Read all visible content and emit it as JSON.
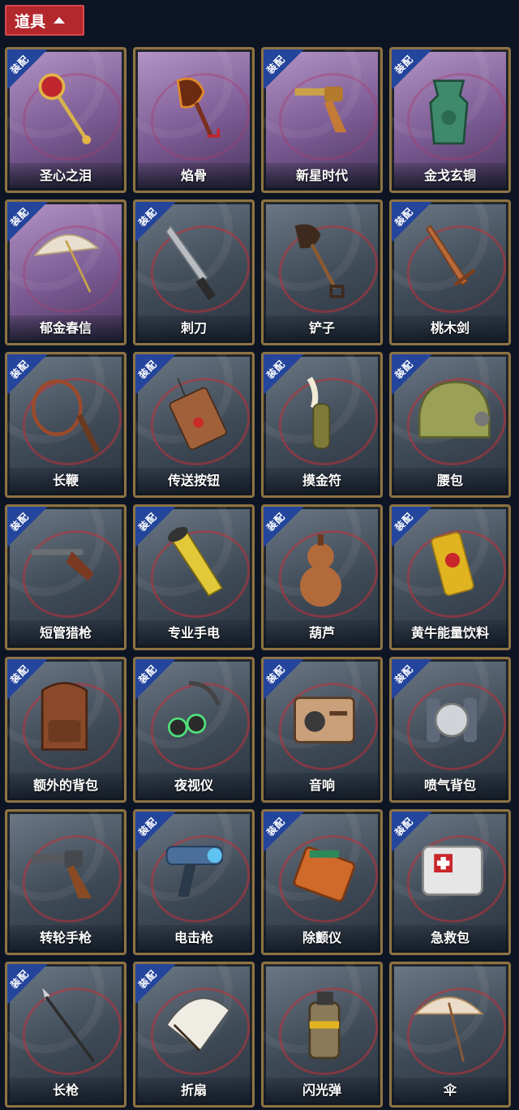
{
  "header": {
    "title": "道具"
  },
  "badge_text": "装配",
  "items": [
    {
      "name": "圣心之泪",
      "equipped": true,
      "purple": true,
      "icon": "scepter-icon"
    },
    {
      "name": "焰骨",
      "equipped": false,
      "purple": true,
      "icon": "bone-shovel-icon"
    },
    {
      "name": "新星时代",
      "equipped": true,
      "purple": true,
      "icon": "revolver-icon"
    },
    {
      "name": "金戈玄铜",
      "equipped": true,
      "purple": true,
      "icon": "bronze-relic-icon"
    },
    {
      "name": "郁金春信",
      "equipped": true,
      "purple": true,
      "icon": "parasol-icon"
    },
    {
      "name": "刺刀",
      "equipped": true,
      "purple": false,
      "icon": "knife-icon"
    },
    {
      "name": "铲子",
      "equipped": false,
      "purple": false,
      "icon": "shovel-icon"
    },
    {
      "name": "桃木剑",
      "equipped": true,
      "purple": false,
      "icon": "wooden-sword-icon"
    },
    {
      "name": "长鞭",
      "equipped": true,
      "purple": false,
      "icon": "whip-icon"
    },
    {
      "name": "传送按钮",
      "equipped": true,
      "purple": false,
      "icon": "remote-button-icon"
    },
    {
      "name": "摸金符",
      "equipped": true,
      "purple": false,
      "icon": "amulet-icon"
    },
    {
      "name": "腰包",
      "equipped": true,
      "purple": false,
      "icon": "waist-bag-icon"
    },
    {
      "name": "短管猎枪",
      "equipped": true,
      "purple": false,
      "icon": "shotgun-icon"
    },
    {
      "name": "专业手电",
      "equipped": true,
      "purple": false,
      "icon": "flashlight-icon"
    },
    {
      "name": "葫芦",
      "equipped": true,
      "purple": false,
      "icon": "gourd-icon"
    },
    {
      "name": "黄牛能量饮料",
      "equipped": true,
      "purple": false,
      "icon": "energy-drink-icon"
    },
    {
      "name": "额外的背包",
      "equipped": true,
      "purple": false,
      "icon": "backpack-icon"
    },
    {
      "name": "夜视仪",
      "equipped": true,
      "purple": false,
      "icon": "night-vision-icon"
    },
    {
      "name": "音响",
      "equipped": true,
      "purple": false,
      "icon": "radio-icon"
    },
    {
      "name": "喷气背包",
      "equipped": true,
      "purple": false,
      "icon": "jetpack-icon"
    },
    {
      "name": "转轮手枪",
      "equipped": false,
      "purple": false,
      "icon": "pistol-icon"
    },
    {
      "name": "电击枪",
      "equipped": true,
      "purple": false,
      "icon": "shock-gun-icon"
    },
    {
      "name": "除颤仪",
      "equipped": true,
      "purple": false,
      "icon": "defibrillator-icon"
    },
    {
      "name": "急救包",
      "equipped": true,
      "purple": false,
      "icon": "first-aid-icon"
    },
    {
      "name": "长枪",
      "equipped": true,
      "purple": false,
      "icon": "spear-icon"
    },
    {
      "name": "折扇",
      "equipped": true,
      "purple": false,
      "icon": "folding-fan-icon"
    },
    {
      "name": "闪光弹",
      "equipped": false,
      "purple": false,
      "icon": "flashbang-icon"
    },
    {
      "name": "伞",
      "equipped": false,
      "purple": false,
      "icon": "umbrella-icon"
    }
  ]
}
